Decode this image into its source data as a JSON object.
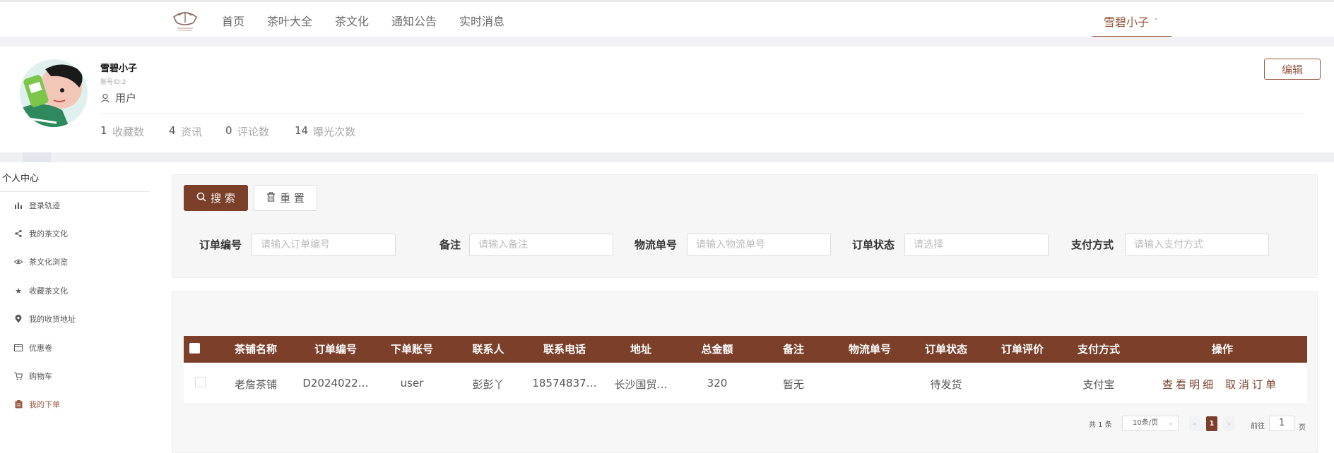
{
  "nav": {
    "items": [
      "首页",
      "茶叶大全",
      "茶文化",
      "通知公告",
      "实时消息"
    ],
    "user": "雪碧小子"
  },
  "profile": {
    "name": "雪碧小子",
    "account_id": "账号ID:2",
    "role": "用户",
    "edit_label": "编辑",
    "stats": [
      {
        "num": "1",
        "label": "收藏数"
      },
      {
        "num": "4",
        "label": "资讯"
      },
      {
        "num": "0",
        "label": "评论数"
      },
      {
        "num": "14",
        "label": "曝光次数"
      }
    ]
  },
  "sidebar": {
    "title": "个人中心",
    "items": [
      {
        "label": "登录轨迹",
        "icon": "bar-chart-icon"
      },
      {
        "label": "我的茶文化",
        "icon": "share-icon"
      },
      {
        "label": "茶文化浏览",
        "icon": "eye-icon"
      },
      {
        "label": "收藏茶文化",
        "icon": "star-icon"
      },
      {
        "label": "我的收货地址",
        "icon": "location-pin-icon"
      },
      {
        "label": "优惠卷",
        "icon": "ticket-icon"
      },
      {
        "label": "购物车",
        "icon": "cart-icon"
      },
      {
        "label": "我的下单",
        "icon": "clipboard-icon",
        "active": true
      }
    ]
  },
  "search": {
    "search_label": "搜 索",
    "reset_label": "重 置",
    "fields": [
      {
        "label": "订单编号",
        "placeholder": "请输入订单编号"
      },
      {
        "label": "备注",
        "placeholder": "请输入备注"
      },
      {
        "label": "物流单号",
        "placeholder": "请输入物流单号"
      },
      {
        "label": "订单状态",
        "placeholder": "请选择"
      },
      {
        "label": "支付方式",
        "placeholder": "请输入支付方式"
      }
    ]
  },
  "table": {
    "headers": [
      "茶铺名称",
      "订单编号",
      "下单账号",
      "联系人",
      "联系电话",
      "地址",
      "总金额",
      "备注",
      "物流单号",
      "订单状态",
      "订单评价",
      "支付方式",
      "操作"
    ],
    "rows": [
      {
        "cells": [
          "老詹茶铺",
          "D2024022…",
          "user",
          "彭彭丫",
          "18574837…",
          "长沙国贸…",
          "320",
          "暂无",
          "",
          "待发货",
          "",
          "支付宝"
        ],
        "actions": [
          "查看明细",
          "取消订单"
        ]
      }
    ]
  },
  "pagination": {
    "total": "共 1 条",
    "page_size": "10条/页",
    "current": "1",
    "goto_label": "前往",
    "goto_value": "1",
    "page_suffix": "页"
  },
  "colors": {
    "accent": "#7b3f2a",
    "user_accent": "#9a5a43"
  }
}
